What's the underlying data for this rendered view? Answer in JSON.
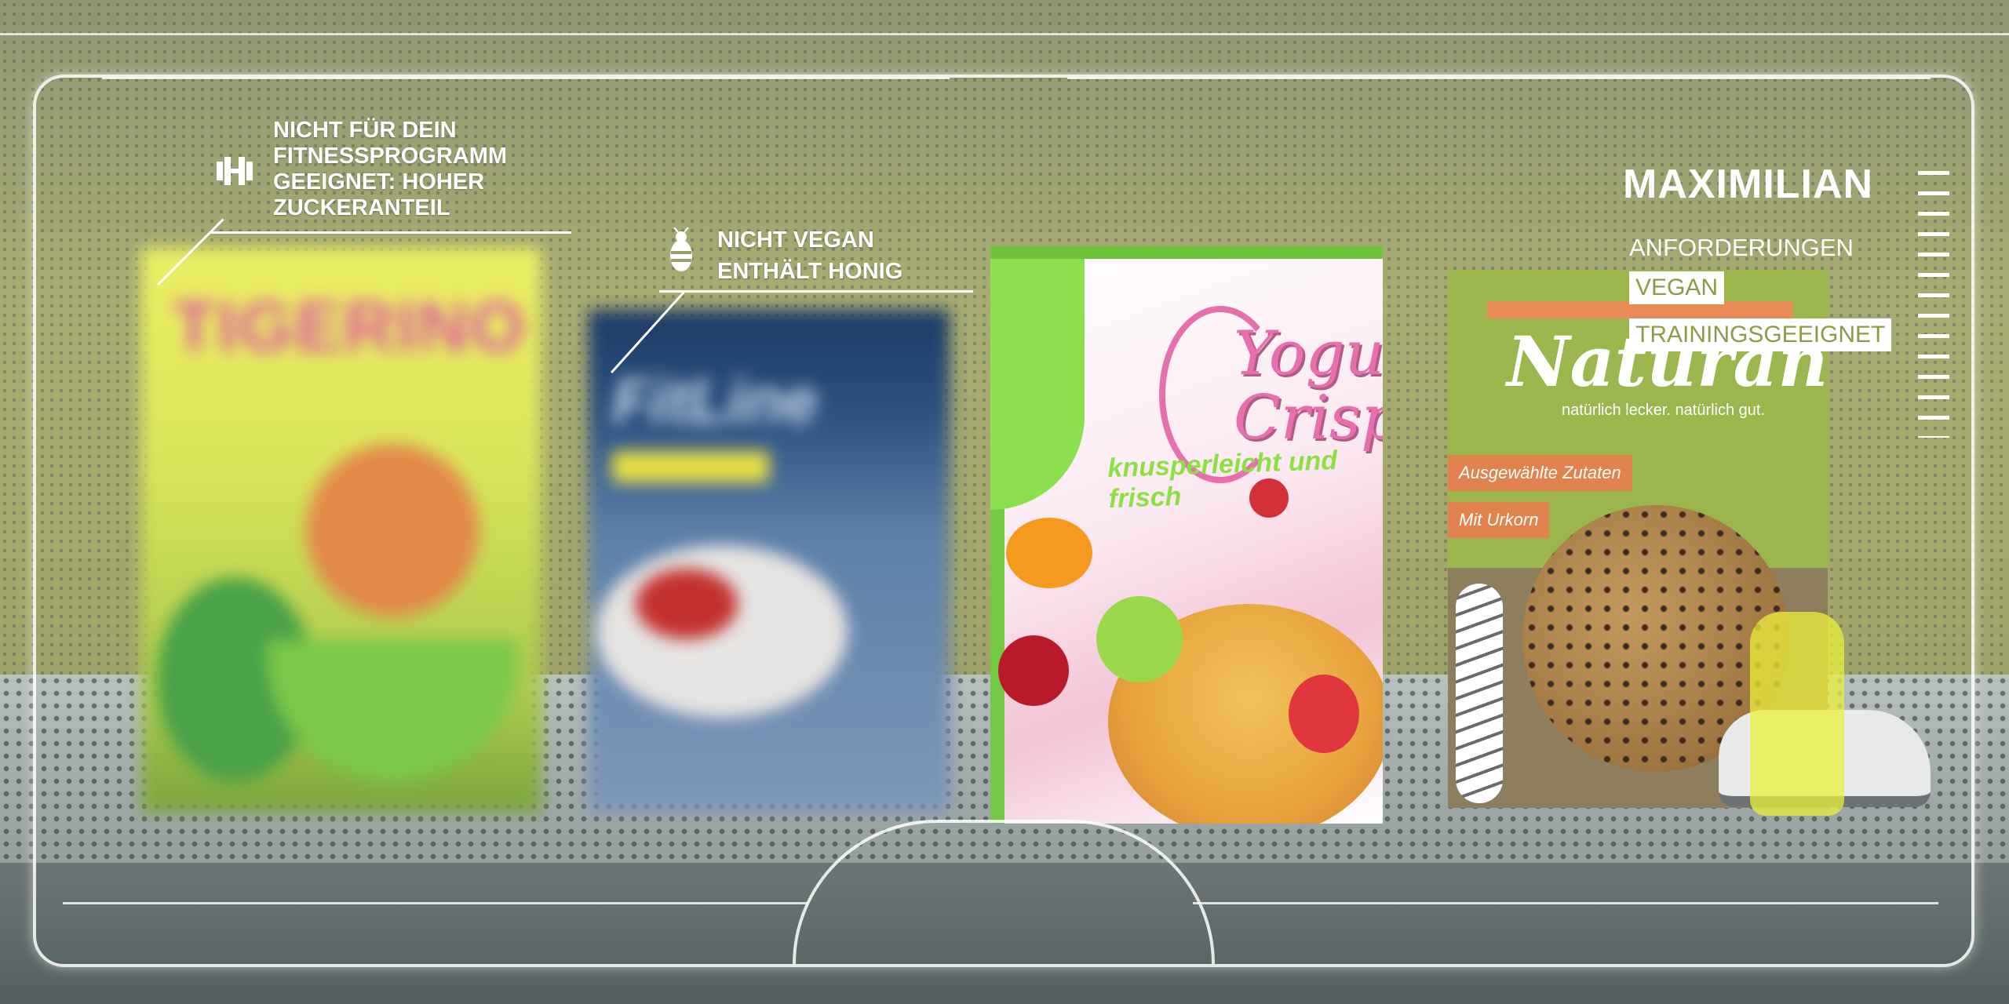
{
  "callouts": {
    "fitness": {
      "icon": "dumbbell-icon",
      "text": "NICHT FÜR DEIN FITNESSPROGRAMM GEEIGNET: HOHER ZUCKERANTEIL"
    },
    "vegan": {
      "icon": "bee-icon",
      "line1": "NICHT VEGAN",
      "line2": "ENTHÄLT HONIG"
    }
  },
  "profile": {
    "name": "MAXIMILIAN",
    "requirements_label": "ANFORDERUNGEN",
    "requirements": [
      "VEGAN",
      "TRAININGSGEEIGNET"
    ]
  },
  "products": {
    "tigerino": {
      "brand": "TIGERINO"
    },
    "fitline": {
      "brand": "FitLine"
    },
    "yogu": {
      "brand_line1": "Yogu",
      "brand_line2": "Crispy",
      "tagline": "knusperleicht und frisch"
    },
    "naturana": {
      "brand": "Naturana",
      "tagline": "natürlich lecker. natürlich gut.",
      "label1": "Ausgewählte Zutaten",
      "label2": "Mit Urkorn"
    }
  },
  "colors": {
    "accent_green": "#8ce045",
    "accent_pink": "#e86fae",
    "hud_white": "#ffffff"
  }
}
